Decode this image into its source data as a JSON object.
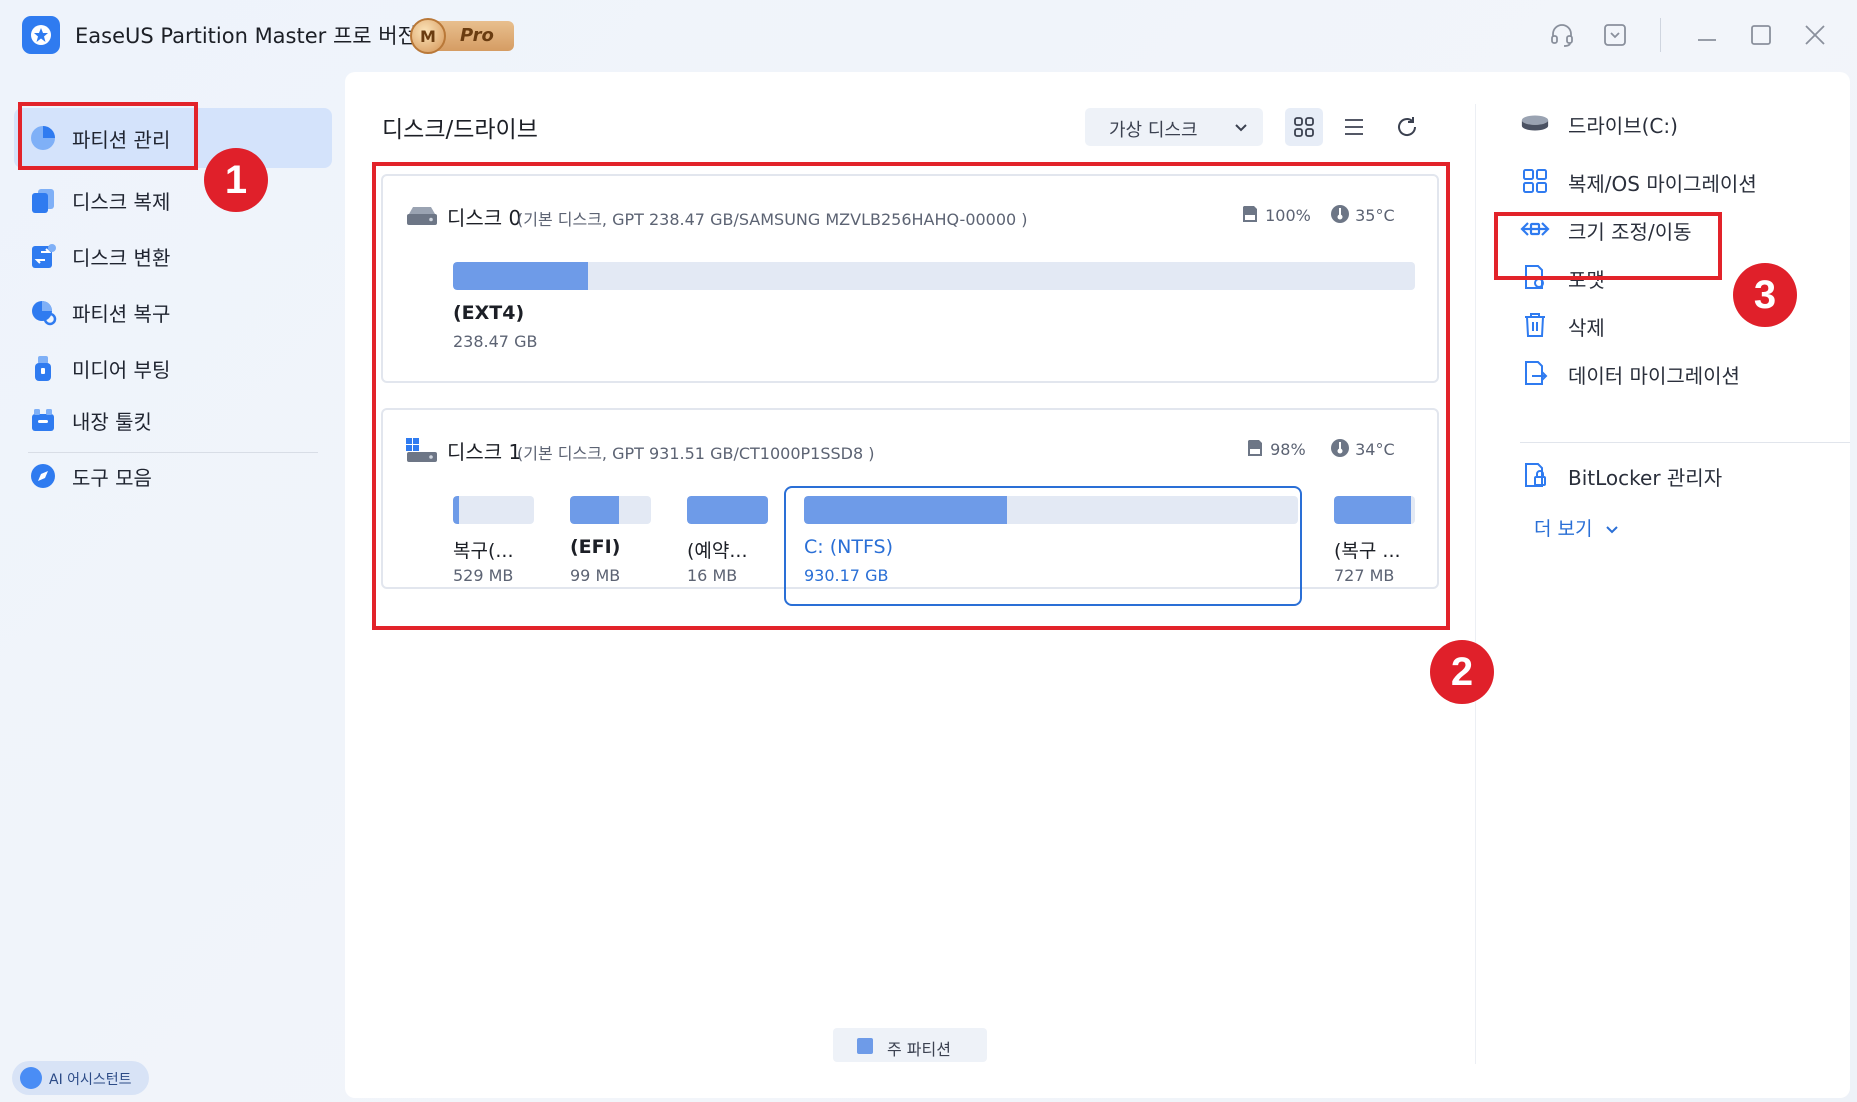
{
  "app": {
    "title": "EaseUS Partition Master 프로 버전",
    "badge_medal": "M",
    "badge_label": "Pro"
  },
  "sidebar": {
    "items": [
      {
        "label": "파티션 관리",
        "icon": "pie-chart-icon",
        "active": true
      },
      {
        "label": "디스크 복제",
        "icon": "clone-icon"
      },
      {
        "label": "디스크 변환",
        "icon": "convert-icon"
      },
      {
        "label": "파티션 복구",
        "icon": "recover-icon"
      },
      {
        "label": "미디어 부팅",
        "icon": "usb-icon"
      }
    ],
    "tools": [
      {
        "label": "내장 툴킷",
        "icon": "toolkit-icon"
      },
      {
        "label": "도구 모음",
        "icon": "compass-icon"
      }
    ],
    "ai_assistant": "AI 어시스턴트"
  },
  "main": {
    "title": "디스크/드라이브",
    "virtual_disk": "가상 디스크",
    "disks": [
      {
        "name": "디스크 0",
        "desc": "(기본 디스크, GPT 238.47 GB/SAMSUNG MZVLB256HAHQ-00000 )",
        "health": "100%",
        "temp": "35°C",
        "partitions": [
          {
            "name": "(EXT4)",
            "size": "238.47 GB",
            "used": 0.14
          }
        ]
      },
      {
        "name": "디스크 1",
        "desc": "(기본 디스크, GPT 931.51 GB/CT1000P1SSD8 )",
        "health": "98%",
        "temp": "34°C",
        "partitions": [
          {
            "name": "복구(...",
            "size": "529 MB",
            "used": 0.08
          },
          {
            "name": "(EFI)",
            "size": "99 MB",
            "used": 0.6
          },
          {
            "name": "(예약...",
            "size": "16 MB",
            "used": 1.0
          },
          {
            "name": "C: (NTFS)",
            "size": "930.17 GB",
            "used": 0.41,
            "selected": true
          },
          {
            "name": "(복구 ...",
            "size": "727 MB",
            "used": 0.95
          }
        ]
      }
    ],
    "legend": "주 파티션"
  },
  "actions": {
    "drive": "드라이브(C:)",
    "items": [
      {
        "label": "복제/OS 마이그레이션",
        "icon": "migrate-icon"
      },
      {
        "label": "크기 조정/이동",
        "icon": "resize-move-icon"
      },
      {
        "label": "포맷",
        "icon": "format-icon"
      },
      {
        "label": "삭제",
        "icon": "trash-icon"
      },
      {
        "label": "데이터 마이그레이션",
        "icon": "data-migrate-icon"
      },
      {
        "label": "BitLocker 관리자",
        "icon": "bitlocker-icon"
      }
    ],
    "more": "더 보기"
  },
  "annotations": {
    "n1": "1",
    "n2": "2",
    "n3": "3"
  },
  "colors": {
    "accent": "#2a6fd6",
    "partition_fill": "#6e9be8",
    "highlight": "#e2232a"
  }
}
